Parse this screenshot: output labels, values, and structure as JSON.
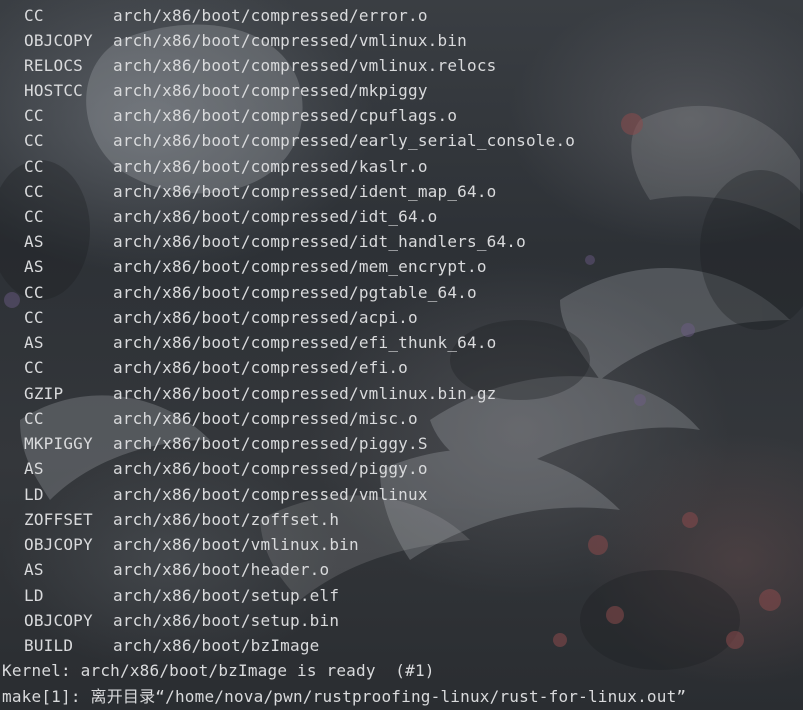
{
  "terminal": {
    "build_lines": [
      {
        "tag": "CC",
        "path": "arch/x86/boot/compressed/error.o"
      },
      {
        "tag": "OBJCOPY",
        "path": "arch/x86/boot/compressed/vmlinux.bin"
      },
      {
        "tag": "RELOCS",
        "path": "arch/x86/boot/compressed/vmlinux.relocs"
      },
      {
        "tag": "HOSTCC",
        "path": "arch/x86/boot/compressed/mkpiggy"
      },
      {
        "tag": "CC",
        "path": "arch/x86/boot/compressed/cpuflags.o"
      },
      {
        "tag": "CC",
        "path": "arch/x86/boot/compressed/early_serial_console.o"
      },
      {
        "tag": "CC",
        "path": "arch/x86/boot/compressed/kaslr.o"
      },
      {
        "tag": "CC",
        "path": "arch/x86/boot/compressed/ident_map_64.o"
      },
      {
        "tag": "CC",
        "path": "arch/x86/boot/compressed/idt_64.o"
      },
      {
        "tag": "AS",
        "path": "arch/x86/boot/compressed/idt_handlers_64.o"
      },
      {
        "tag": "AS",
        "path": "arch/x86/boot/compressed/mem_encrypt.o"
      },
      {
        "tag": "CC",
        "path": "arch/x86/boot/compressed/pgtable_64.o"
      },
      {
        "tag": "CC",
        "path": "arch/x86/boot/compressed/acpi.o"
      },
      {
        "tag": "AS",
        "path": "arch/x86/boot/compressed/efi_thunk_64.o"
      },
      {
        "tag": "CC",
        "path": "arch/x86/boot/compressed/efi.o"
      },
      {
        "tag": "GZIP",
        "path": "arch/x86/boot/compressed/vmlinux.bin.gz"
      },
      {
        "tag": "CC",
        "path": "arch/x86/boot/compressed/misc.o"
      },
      {
        "tag": "MKPIGGY",
        "path": "arch/x86/boot/compressed/piggy.S"
      },
      {
        "tag": "AS",
        "path": "arch/x86/boot/compressed/piggy.o"
      },
      {
        "tag": "LD",
        "path": "arch/x86/boot/compressed/vmlinux"
      },
      {
        "tag": "ZOFFSET",
        "path": "arch/x86/boot/zoffset.h"
      },
      {
        "tag": "OBJCOPY",
        "path": "arch/x86/boot/vmlinux.bin"
      },
      {
        "tag": "AS",
        "path": "arch/x86/boot/header.o"
      },
      {
        "tag": "LD",
        "path": "arch/x86/boot/setup.elf"
      },
      {
        "tag": "OBJCOPY",
        "path": "arch/x86/boot/setup.bin"
      },
      {
        "tag": "BUILD",
        "path": "arch/x86/boot/bzImage"
      }
    ],
    "kernel_ready_line": "Kernel: arch/x86/boot/bzImage is ready  (#1)",
    "make_leave_line": "make[1]: 离开目录“/home/nova/pwn/rustproofing-linux/rust-for-linux.out”"
  },
  "colors": {
    "terminal_text": "#d9dadc"
  }
}
